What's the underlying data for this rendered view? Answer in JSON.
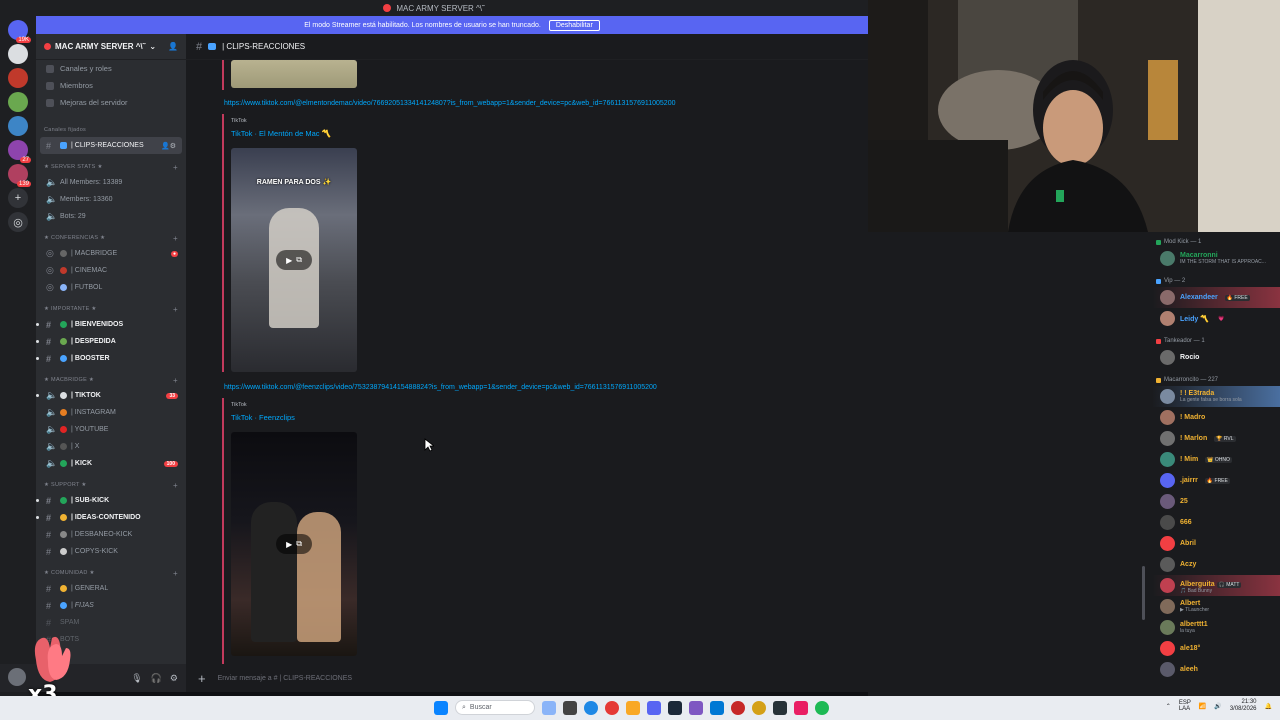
{
  "window": {
    "title": "MAC ARMY SERVER ^\\˜"
  },
  "banner": {
    "text": "El modo Streamer está habilitado. Los nombres de usuario se han truncado.",
    "button": "Deshabilitar"
  },
  "server": {
    "name": "MAC ARMY SERVER ^\\˜"
  },
  "nav": [
    "Canales y roles",
    "Miembros",
    "Mejoras del servidor"
  ],
  "pinned_label": "Canales fijados",
  "active_channel": "| CLIPS-REACCIONES",
  "categories": {
    "stats": "★ SERVER STATS ★",
    "conferencias": "★ CONFERENCIAS ★",
    "importante": "★ IMPORTANTE ★",
    "macbridge": "★ MACBRIDGE ★",
    "support": "★ SUPPORT ★",
    "comunidad": "★ COMUNIDAD ★"
  },
  "stats": [
    "All Members: 13389",
    "Members: 13360",
    "Bots: 29"
  ],
  "conf": [
    "| MACBRIDGE",
    "| CINEMAC",
    "| FUTBOL"
  ],
  "importante": [
    "| BIENVENIDOS",
    "| DESPEDIDA",
    "| BOOSTER"
  ],
  "macbridge": [
    "| TIKTOK",
    "| INSTAGRAM",
    "| YOUTUBE",
    "| X",
    "| KICK"
  ],
  "macbridge_badges": {
    "tiktok": "33",
    "kick": "100"
  },
  "support": [
    "| SUB-KICK",
    "| IDEAS-CONTENIDO",
    "| DESBANEO-KICK",
    "| COPYS-KICK"
  ],
  "comunidad": [
    "| GENERAL",
    "| FIJAS",
    "SPAM",
    "BOTS"
  ],
  "messages": [
    {
      "link": "https://www.tiktok.com/@elmentondemac/video/7669205133414124807?is_from_webapp=1&sender_device=pc&web_id=7661131576911005200",
      "provider": "TikTok",
      "title": "TikTok · El Mentón de Mac 〽️",
      "caption": "RAMEN PARA DOS ✨"
    },
    {
      "link": "https://www.tiktok.com/@feenzclips/video/7532387941415488824?is_from_webapp=1&sender_device=pc&web_id=7661131576911005200",
      "provider": "TikTok",
      "title": "TikTok · Feenzclips"
    }
  ],
  "input": {
    "placeholder": "Enviar mensaje a #",
    "channel": "| CLIPS-REACCIONES"
  },
  "member_groups": [
    {
      "label": "Mod Kick — 1",
      "color": "#23a55a"
    },
    {
      "label": "Vip — 2",
      "color": "#4aa3ff"
    },
    {
      "label": "Tankeador — 1",
      "color": "#f23f43"
    },
    {
      "label": "Macarroncito — 227",
      "color": "#f0b232"
    }
  ],
  "members": {
    "mod": [
      {
        "name": "Macarronni",
        "sub": "IM THE STORM THAT IS APPROAC...",
        "color": "#23a55a"
      }
    ],
    "vip": [
      {
        "name": "Alexandeer",
        "tag": "🔥 FREE",
        "color": "#4aa3ff"
      },
      {
        "name": "Leidy 〽️",
        "tag": "💗",
        "color": "#4aa3ff"
      }
    ],
    "tank": [
      {
        "name": "Rocio",
        "color": "#f23f43"
      }
    ],
    "maca": [
      {
        "name": "! ! E3trada",
        "sub": "La gente falsa se borra sola",
        "color": "#f0b232"
      },
      {
        "name": "! Madro",
        "color": "#f0b232"
      },
      {
        "name": "! Marlon",
        "tag": "🏆 RVL",
        "color": "#f0b232"
      },
      {
        "name": "! Mim",
        "tag": "👑 OHNO",
        "color": "#f0b232"
      },
      {
        "name": ".jairrr",
        "tag": "🔥 FREE",
        "color": "#f0b232"
      },
      {
        "name": "25",
        "color": "#f0b232"
      },
      {
        "name": "666",
        "color": "#f0b232"
      },
      {
        "name": "Abril",
        "color": "#f0b232"
      },
      {
        "name": "Aczy",
        "color": "#f0b232"
      },
      {
        "name": "Alberguita",
        "tag": "🎧 MATT",
        "sub": "🎵 Bad Bunny",
        "color": "#f0b232"
      },
      {
        "name": "Albert",
        "sub": "▶ TLauncher",
        "color": "#f0b232"
      },
      {
        "name": "alberttt1",
        "sub": "la tuya",
        "color": "#f0b232"
      },
      {
        "name": "ale18°",
        "color": "#f0b232"
      },
      {
        "name": "aleeh",
        "color": "#f0b232"
      }
    ]
  },
  "taskbar": {
    "search": "Buscar",
    "lang": "ESP\nLAA",
    "time": "21:30",
    "date": "3/08/2026"
  },
  "overlay": {
    "multiplier": "x3"
  },
  "colors": {
    "accent": "#5865f2",
    "link": "#00a8fc",
    "embed_bar": "#c23a5c"
  }
}
